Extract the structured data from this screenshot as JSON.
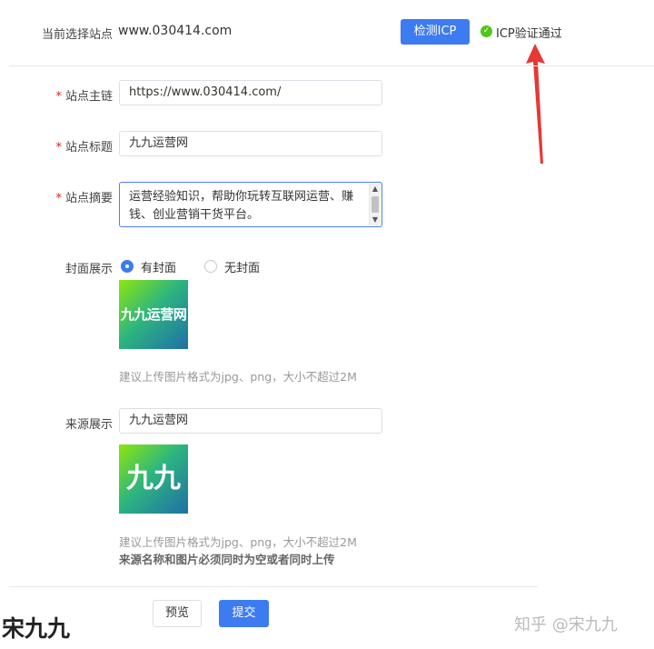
{
  "header": {
    "current_site_label": "当前选择站点",
    "current_site_value": "www.030414.com",
    "check_icp_button": "检测ICP",
    "icp_status": "ICP验证通过",
    "colors": {
      "primary": "#3d7bf0",
      "success": "#52c41a",
      "required": "#e2231a",
      "annotation_arrow": "#e53935"
    }
  },
  "form": {
    "site_url": {
      "label": "站点主链",
      "value": "https://www.030414.com/"
    },
    "site_title": {
      "label": "站点标题",
      "value": "九九运营网"
    },
    "site_summary": {
      "label": "站点摘要",
      "value_line1": "运营经验知识，帮助你玩转互联网运营、赚",
      "value_line2": "钱、创业营销干货平台。"
    },
    "cover_display": {
      "label": "封面展示",
      "options": [
        {
          "label": "有封面",
          "selected": true
        },
        {
          "label": "无封面",
          "selected": false
        }
      ],
      "image_text": "九九运营网",
      "hint": "建议上传图片格式为jpg、png，大小不超过2M"
    },
    "source_display": {
      "label": "来源展示",
      "value": "九九运营网",
      "image_text": "九九",
      "hint": "建议上传图片格式为jpg、png，大小不超过2M",
      "note": "来源名称和图片必须同时为空或者同时上传"
    }
  },
  "footer": {
    "preview_button": "预览",
    "submit_button": "提交"
  },
  "watermarks": {
    "left": "宋九九",
    "right": "知乎 @宋九九"
  }
}
